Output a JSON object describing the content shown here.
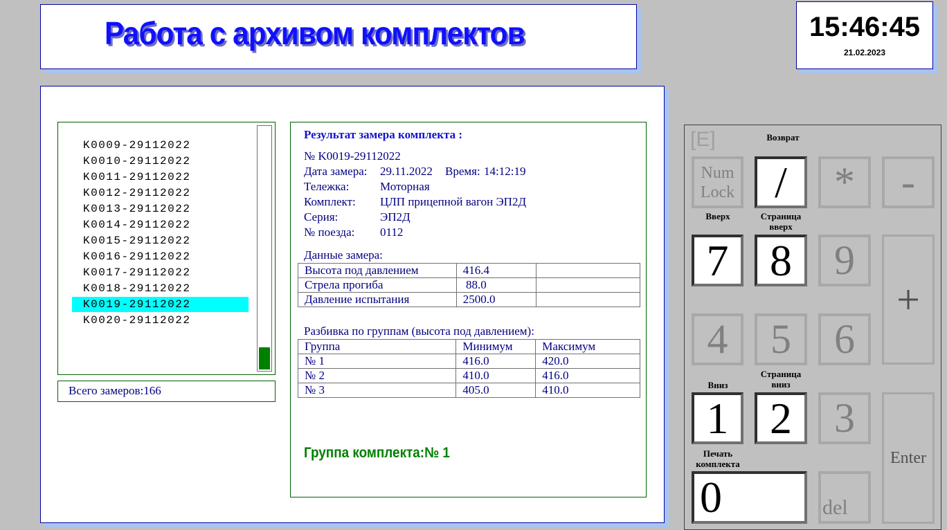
{
  "header": {
    "title": "Работа с архивом комплектов"
  },
  "clock": {
    "time": "15:46:45",
    "date": "21.02.2023"
  },
  "list": {
    "items": [
      "K0009-29112022",
      "K0010-29112022",
      "K0011-29112022",
      "K0012-29112022",
      "K0013-29112022",
      "K0014-29112022",
      "K0015-29112022",
      "K0016-29112022",
      "K0017-29112022",
      "K0018-29112022",
      "K0019-29112022",
      "K0020-29112022"
    ],
    "selected_index": 10,
    "total_label": "Всего замеров:166"
  },
  "result": {
    "heading": "Результат замера комплекта :",
    "number": "№ K0019-29112022",
    "date_label": "Дата замера:",
    "date": "29.11.2022",
    "time_label": "Время:",
    "time": "14:12:19",
    "fields": [
      {
        "label": "Тележка:",
        "value": "Моторная"
      },
      {
        "label": "Комплект:",
        "value": "ЦЛП прицепной вагон ЭП2Д"
      },
      {
        "label": "Серия:",
        "value": "ЭП2Д"
      },
      {
        "label": "№ поезда:",
        "value": "0112"
      }
    ],
    "measure_title": "Данные замера:",
    "measure_rows": [
      [
        "Высота под давлением",
        "416.4",
        ""
      ],
      [
        "Стрела прогиба",
        " 88.0",
        ""
      ],
      [
        "Давление испытания",
        "2500.0",
        ""
      ]
    ],
    "groups_title": "Разбивка по группам (высота под давлением):",
    "groups_header": [
      "Группа",
      "Минимум",
      "Максимум"
    ],
    "groups_rows": [
      [
        "№ 1",
        "416.0",
        "420.0"
      ],
      [
        "№ 2",
        "410.0",
        "416.0"
      ],
      [
        "№ 3",
        "405.0",
        "410.0"
      ]
    ],
    "group_result": "Группа комплекта:№ 1"
  },
  "keypad": {
    "e_label": "[E]",
    "labels": {
      "back": "Возврат",
      "up": "Вверх",
      "page_up": "Страница вверх",
      "down": "Вниз",
      "page_down": "Страница вниз",
      "print": "Печать комплекта"
    },
    "keys": {
      "numlock": "Num Lock",
      "slash": "/",
      "star": "*",
      "minus": "-",
      "k7": "7",
      "k8": "8",
      "k9": "9",
      "plus": "+",
      "k4": "4",
      "k5": "5",
      "k6": "6",
      "k1": "1",
      "k2": "2",
      "k3": "3",
      "enter": "Enter",
      "k0": "0",
      "del": "del"
    }
  }
}
